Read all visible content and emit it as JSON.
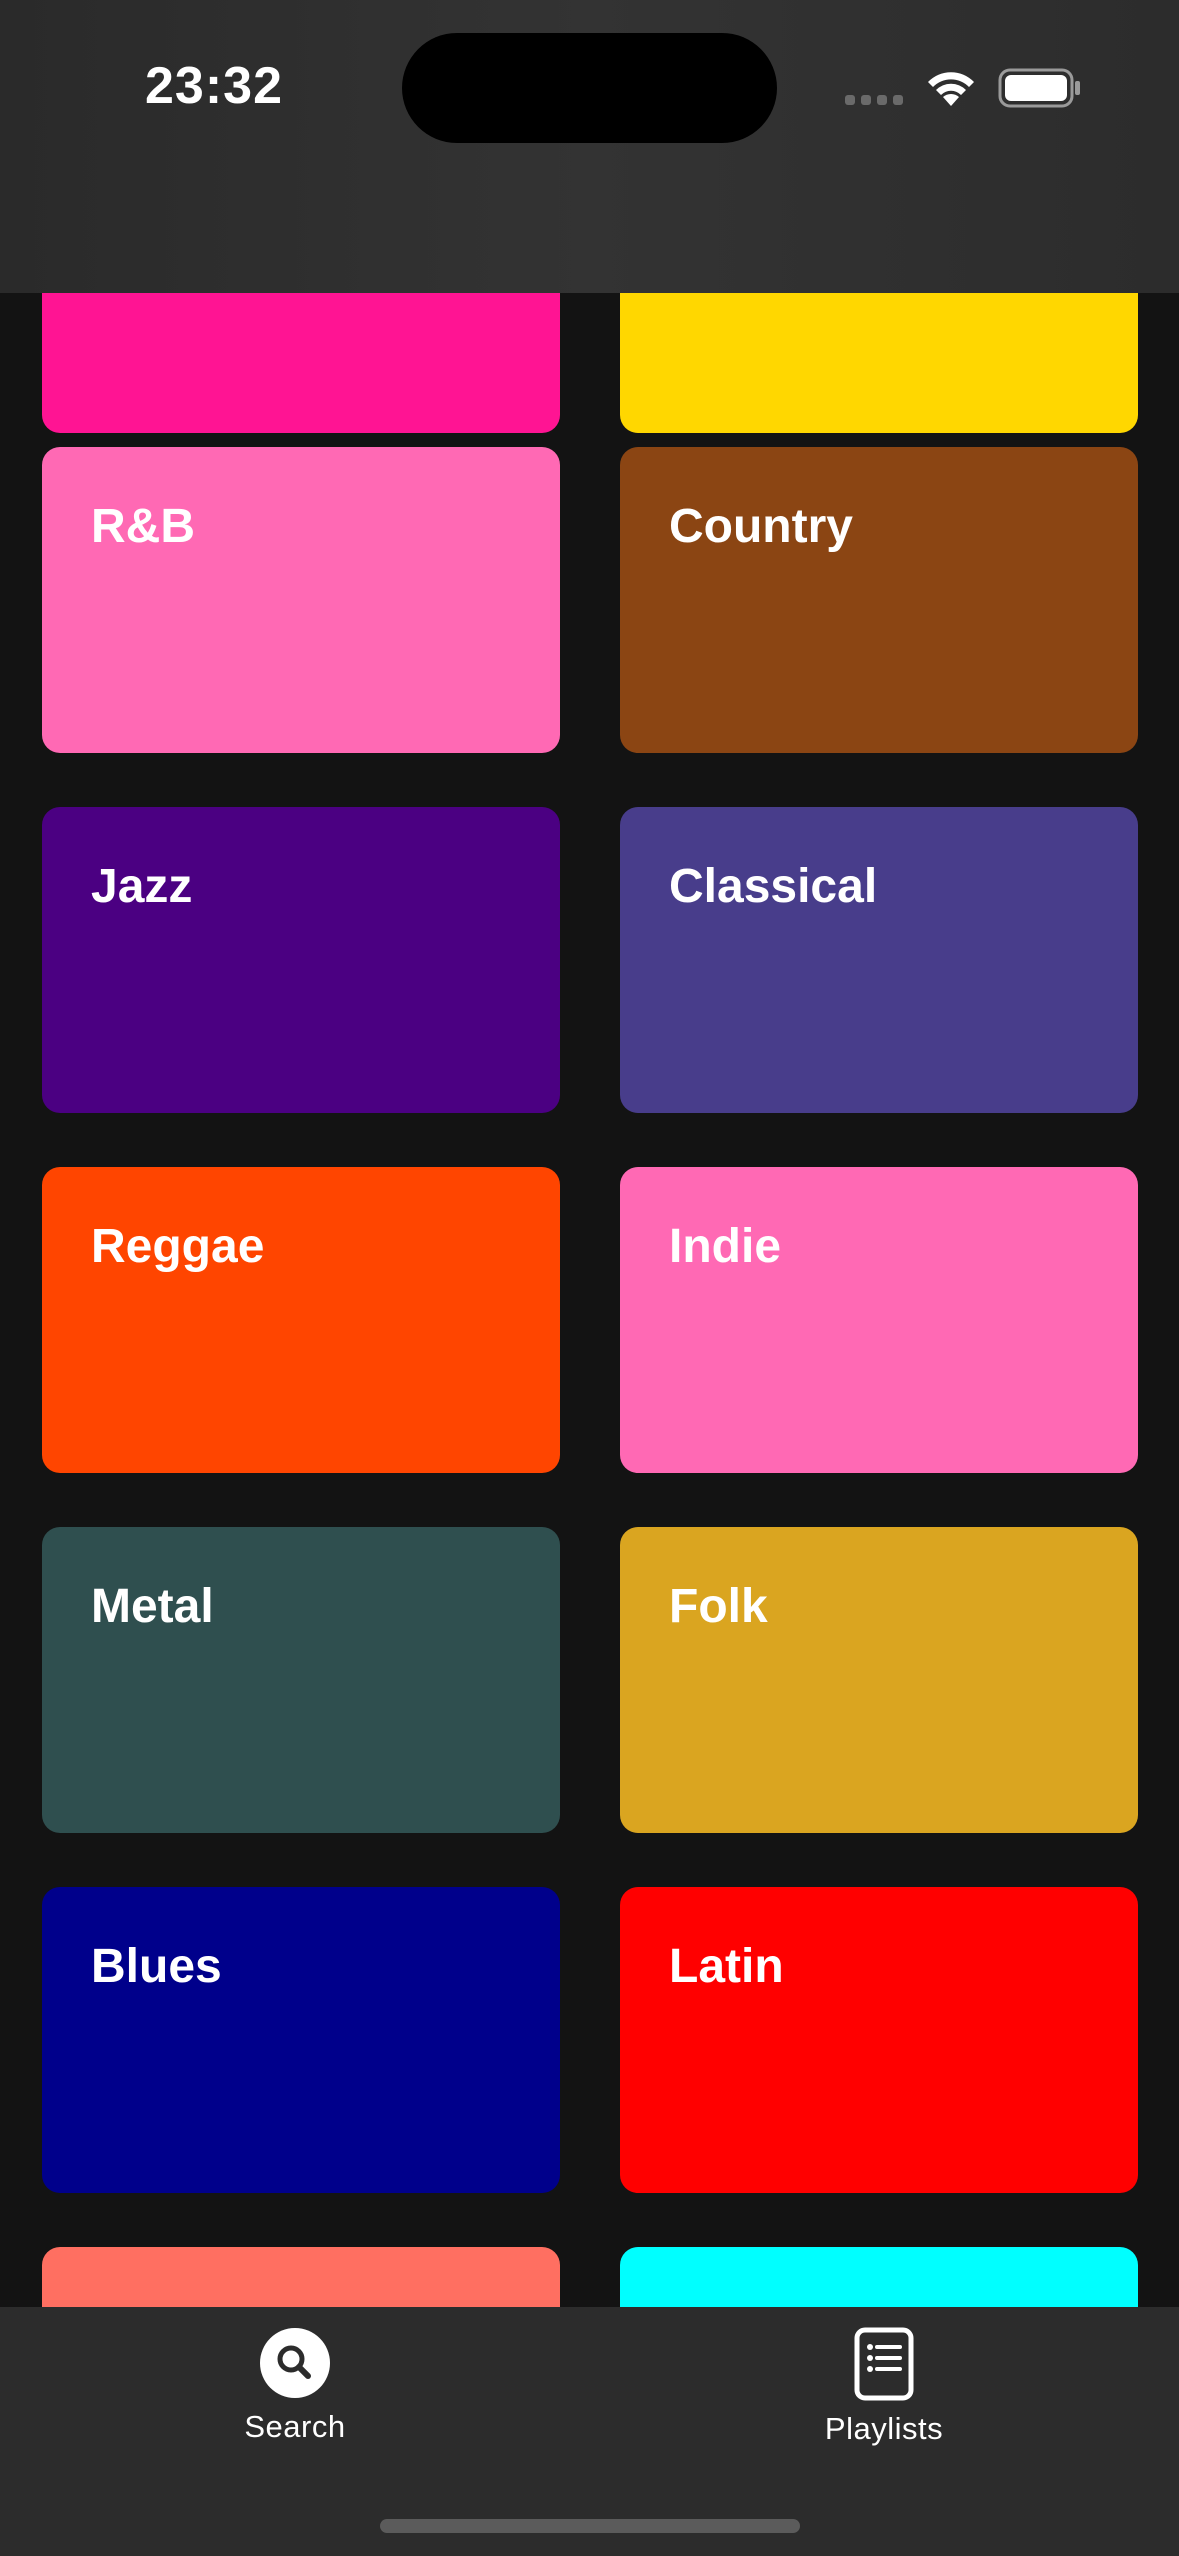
{
  "status_bar": {
    "time": "23:32"
  },
  "genres": [
    {
      "label": "",
      "color": "#FF1493"
    },
    {
      "label": "",
      "color": "#FFD700"
    },
    {
      "label": "R&B",
      "color": "#FF69B4"
    },
    {
      "label": "Country",
      "color": "#8B4513"
    },
    {
      "label": "Jazz",
      "color": "#4B0082"
    },
    {
      "label": "Classical",
      "color": "#483D8B"
    },
    {
      "label": "Reggae",
      "color": "#FF4500"
    },
    {
      "label": "Indie",
      "color": "#FF69B4"
    },
    {
      "label": "Metal",
      "color": "#2F4F4F"
    },
    {
      "label": "Folk",
      "color": "#DAA520"
    },
    {
      "label": "Blues",
      "color": "#00008B"
    },
    {
      "label": "Latin",
      "color": "#FF0000"
    },
    {
      "label": "",
      "color": "#FF6F61"
    },
    {
      "label": "",
      "color": "#00FFFF"
    }
  ],
  "tab_bar": {
    "search_label": "Search",
    "playlists_label": "Playlists",
    "search_icon": "search-icon",
    "playlists_icon": "playlist-icon"
  }
}
